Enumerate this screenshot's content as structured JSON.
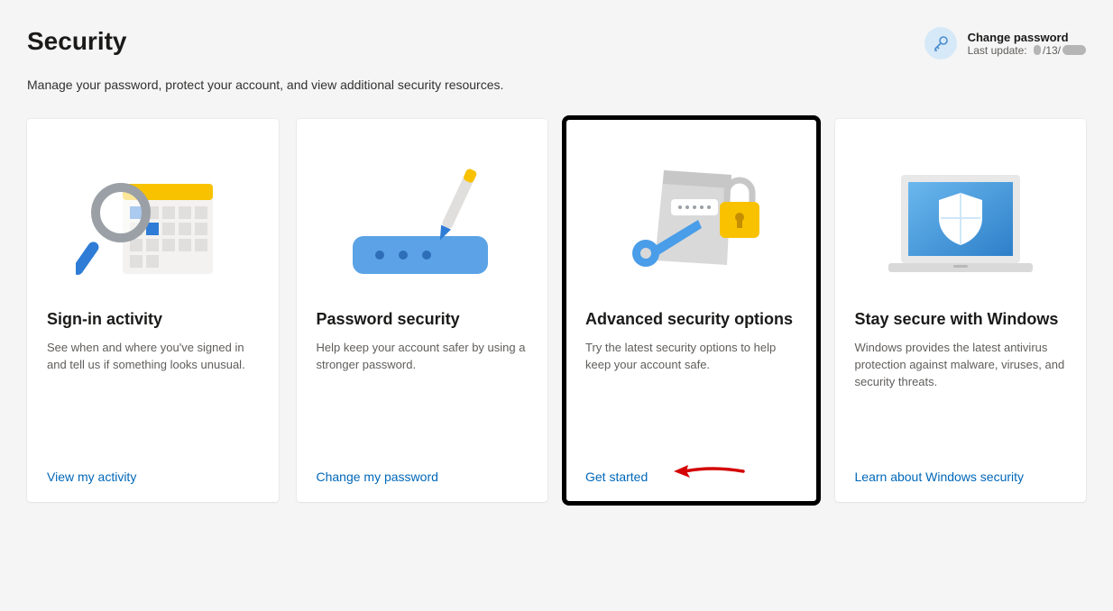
{
  "header": {
    "title": "Security",
    "change_password": {
      "title": "Change password",
      "last_update_prefix": "Last update:",
      "date_middle": "/13/"
    }
  },
  "subtitle": "Manage your password, protect your account, and view additional security resources.",
  "cards": [
    {
      "title": "Sign-in activity",
      "desc": "See when and where you've signed in and tell us if something looks unusual.",
      "link": "View my activity"
    },
    {
      "title": "Password security",
      "desc": "Help keep your account safer by using a stronger password.",
      "link": "Change my password"
    },
    {
      "title": "Advanced security options",
      "desc": "Try the latest security options to help keep your account safe.",
      "link": "Get started"
    },
    {
      "title": "Stay secure with Windows",
      "desc": "Windows provides the latest antivirus protection against malware, viruses, and security threats.",
      "link": "Learn about Windows security"
    }
  ]
}
